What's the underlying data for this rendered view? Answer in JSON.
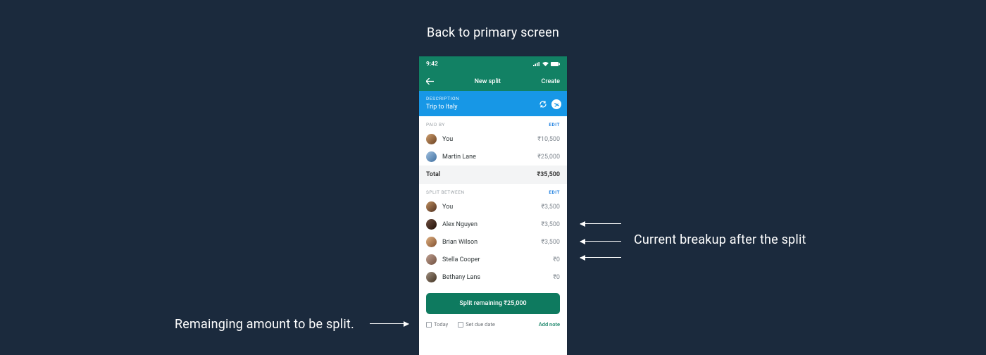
{
  "annotations": {
    "top": "Back to primary screen",
    "right": "Current breakup after the split",
    "left": "Remainging amount to be split."
  },
  "status": {
    "time": "9:42"
  },
  "nav": {
    "back": "←",
    "title": "New split",
    "create": "Create"
  },
  "description": {
    "label": "DESCRIPTION",
    "value": "Trip to Italy"
  },
  "paidBy": {
    "label": "PAID BY",
    "edit": "EDIT",
    "rows": [
      {
        "name": "You",
        "amount": "₹10,500"
      },
      {
        "name": "Martin Lane",
        "amount": "₹25,000"
      }
    ],
    "totalLabel": "Total",
    "totalAmount": "₹35,500"
  },
  "splitBetween": {
    "label": "SPLIT BETWEEN",
    "edit": "EDIT",
    "rows": [
      {
        "name": "You",
        "amount": "₹3,500"
      },
      {
        "name": "Alex Nguyen",
        "amount": "₹3,500"
      },
      {
        "name": "Brian Wilson",
        "amount": "₹3,500"
      },
      {
        "name": "Stella Cooper",
        "amount": "₹0"
      },
      {
        "name": "Bethany Lans",
        "amount": "₹0"
      }
    ]
  },
  "cta": "Split remaining ₹25,000",
  "footer": {
    "today": "Today",
    "due": "Set due date",
    "note": "Add note"
  },
  "avatarColors": [
    "linear-gradient(135deg,#d0a070,#6a4020)",
    "linear-gradient(135deg,#a0c0e0,#4070a0)",
    "linear-gradient(135deg,#c09060,#503020)",
    "linear-gradient(135deg,#705040,#201008)",
    "linear-gradient(135deg,#e0b080,#805030)",
    "linear-gradient(135deg,#c0a090,#705040)",
    "linear-gradient(135deg,#a09080,#403020)"
  ]
}
